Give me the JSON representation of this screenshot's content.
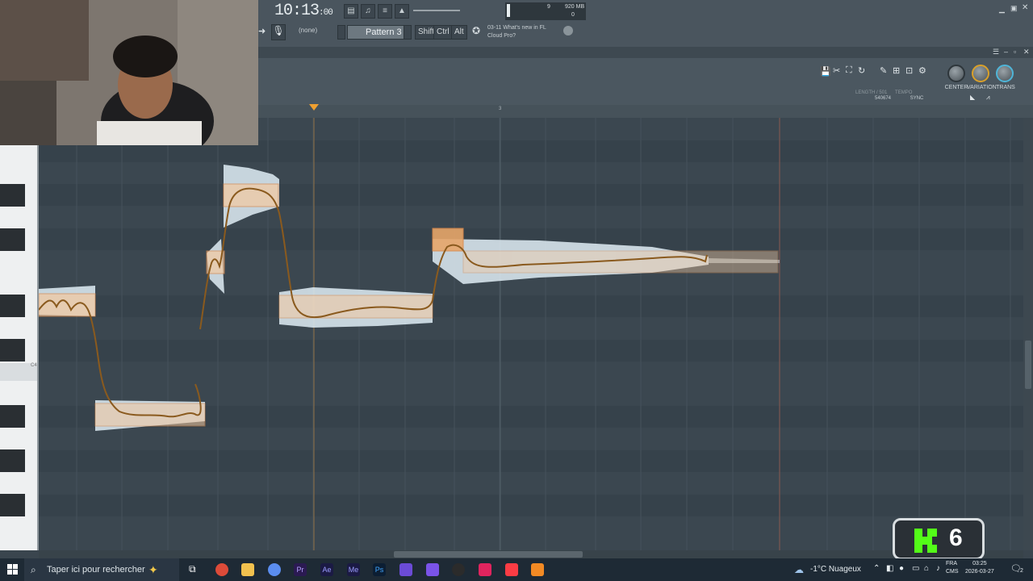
{
  "toolbar": {
    "time": "10:13",
    "time_small": ":00",
    "pattern": "Pattern 3",
    "selector": "(none)",
    "keys": [
      "Shift",
      "Ctrl",
      "Alt"
    ],
    "cpu_value": "9",
    "ram": "920 MB",
    "ram_sub": "0",
    "news_date": "03-11",
    "news_title": "What's new in FL",
    "news_sub": "Cloud Pro?"
  },
  "pitch_editor": {
    "knobs": [
      {
        "label": "CENTER"
      },
      {
        "label": "VARIATION"
      },
      {
        "label": "TRANS"
      }
    ],
    "meta_length": "LENGTH / 501",
    "meta_value": "540674",
    "meta_tempo": "TEMPO",
    "meta_sync": "SYNC",
    "ruler_mark": "3",
    "key_label": "C4"
  },
  "taskbar": {
    "search_placeholder": "Taper ici pour rechercher",
    "weather": "-1°C  Nuageux",
    "lang_top": "FRA",
    "lang_bottom": "CMS",
    "time": "03:25",
    "date": "2026-03-27",
    "notif_count": "2"
  },
  "overlay": {
    "kick_count": "6"
  },
  "colors": {
    "note_fill": "#f4c9a0",
    "pitch_curve": "#8a5a1e",
    "accent": "#f0a030"
  }
}
